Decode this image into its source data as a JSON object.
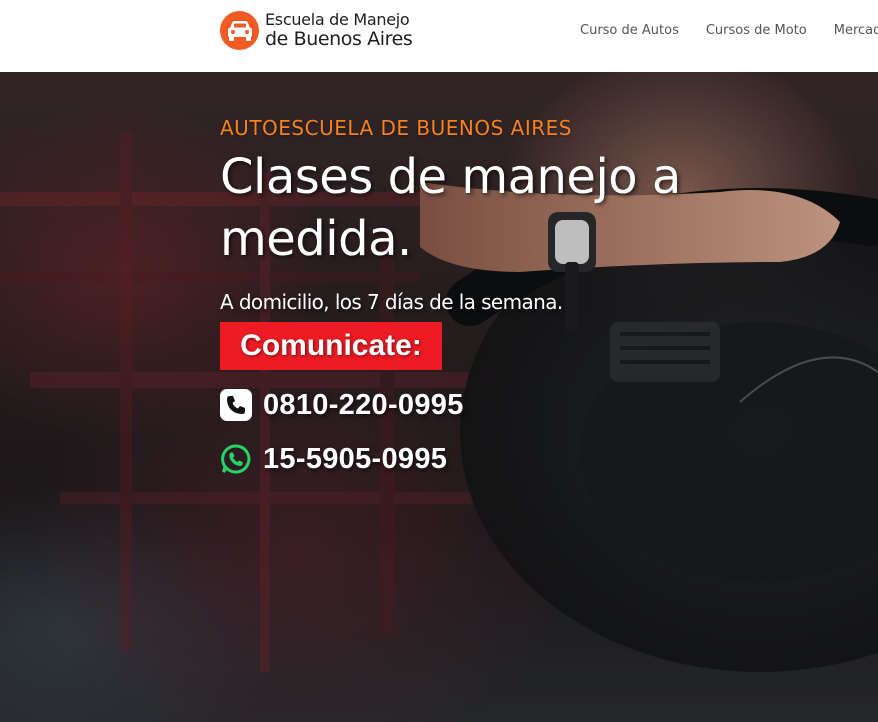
{
  "header": {
    "logo": {
      "line1": "Escuela de Manejo",
      "line2": "de Buenos Aires",
      "icon": "car-icon",
      "badge_color": "#f05a23"
    },
    "nav": [
      {
        "label": "Curso de Autos"
      },
      {
        "label": "Cursos de Moto"
      },
      {
        "label": "Mercado"
      }
    ]
  },
  "hero": {
    "eyebrow": "AUTOESCUELA DE BUENOS AIRES",
    "headline": "Clases de manejo a medida.",
    "subtitle": "A domicilio, los 7 días de la semana.",
    "cta_label": "Comunicate:",
    "phone": {
      "icon": "phone-icon",
      "number": "0810-220-0995"
    },
    "whatsapp": {
      "icon": "whatsapp-icon",
      "number": "15-5905-0995"
    }
  },
  "colors": {
    "accent_orange": "#f58220",
    "cta_red": "#ed1c24",
    "whatsapp_green": "#25d366"
  }
}
